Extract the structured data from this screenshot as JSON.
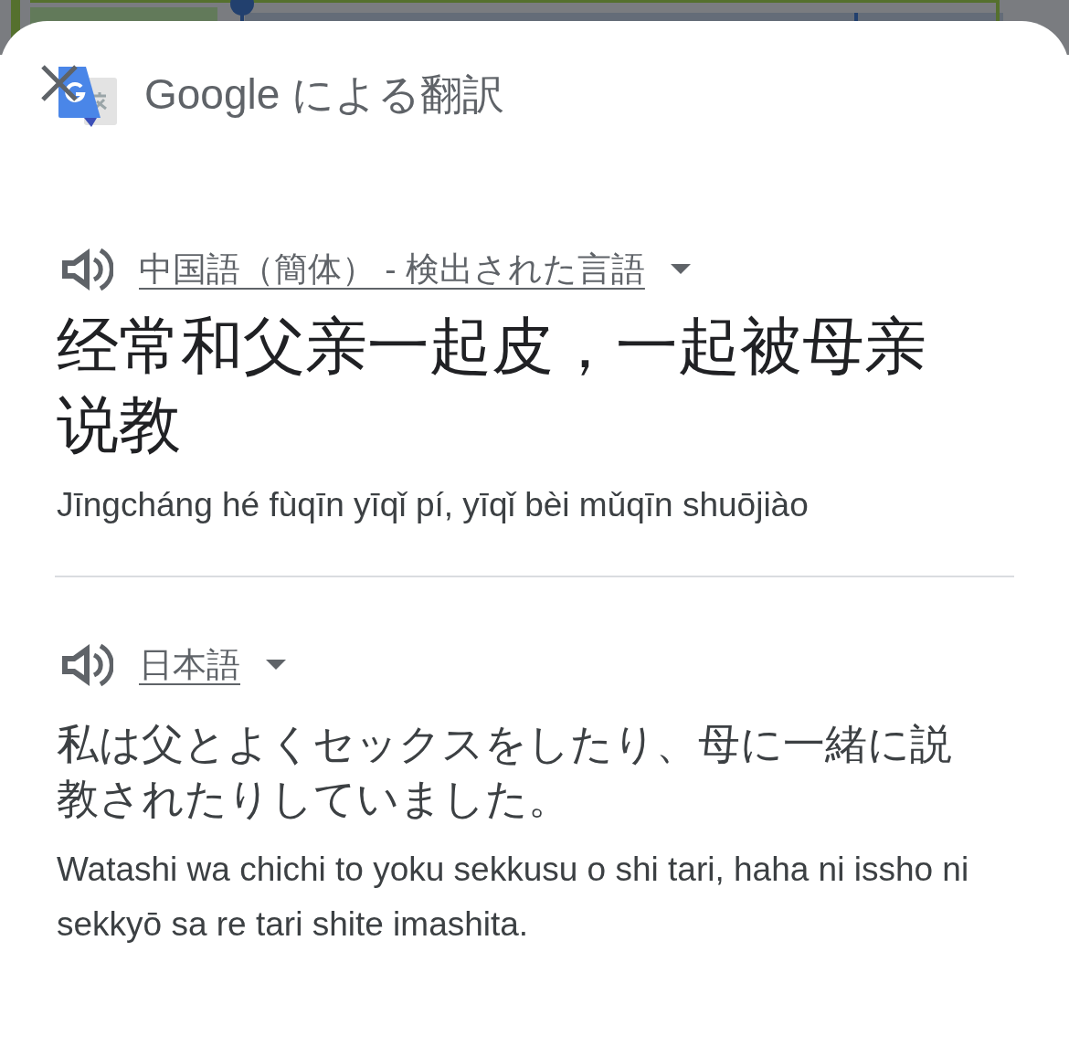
{
  "header": {
    "title": "Google による翻訳"
  },
  "source": {
    "language": "中国語（簡体） - 検出された言語",
    "text": "经常和父亲一起皮，一起被母亲说教",
    "romanization": "Jīngcháng hé fùqīn yīqǐ pí, yīqǐ bèi mǔqīn shuōjiào"
  },
  "target": {
    "language": "日本語",
    "text": "私は父とよくセックスをしたり、母に一緒に説教されたりしていました。",
    "romanization": "Watashi wa chichi to yoku sekkusu o shi tari, haha ni issho ni sekkyō sa re tari shite imashita."
  }
}
